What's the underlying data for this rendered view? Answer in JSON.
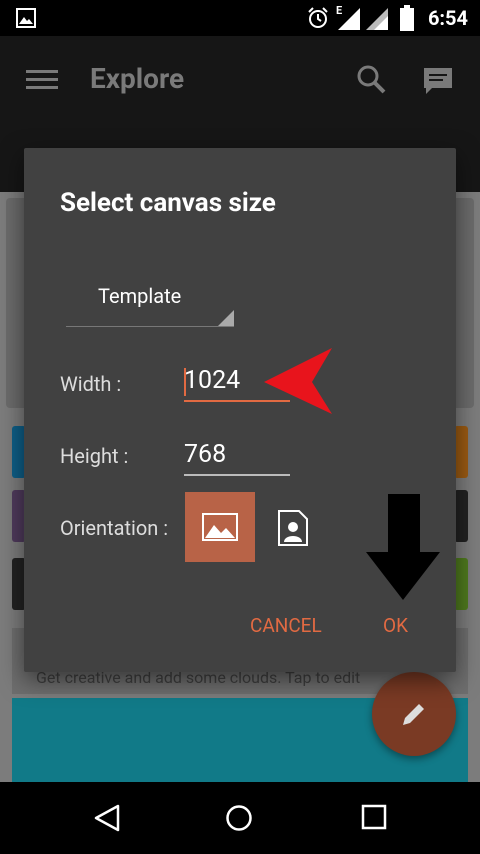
{
  "status_bar": {
    "time": "6:54",
    "network": "E",
    "icons": [
      "image-notification-icon",
      "alarm-icon",
      "signal-icon",
      "battery-icon"
    ]
  },
  "app_bar": {
    "title": "Explore",
    "menu_icon": "hamburger-menu-icon",
    "search_icon": "search-icon",
    "chat_icon": "chat-bubble-icon"
  },
  "background": {
    "card_text": "Get creative and add some clouds. Tap to edit",
    "fab_icon": "pencil-icon"
  },
  "dialog": {
    "title": "Select canvas size",
    "template_label": "Template",
    "width_label": "Width :",
    "width_value": "1024",
    "height_label": "Height :",
    "height_value": "768",
    "orientation_label": "Orientation :",
    "orientation_selected": "landscape",
    "cancel_label": "CANCEL",
    "ok_label": "OK"
  },
  "colors": {
    "accent": "#e26a42",
    "dialog_bg": "#414141",
    "selected_orientation": "#b86347",
    "annotation_red": "#e8141c",
    "annotation_black": "#000000"
  },
  "navigation": {
    "back_icon": "back-triangle-icon",
    "home_icon": "home-circle-icon",
    "recents_icon": "recents-square-icon"
  }
}
